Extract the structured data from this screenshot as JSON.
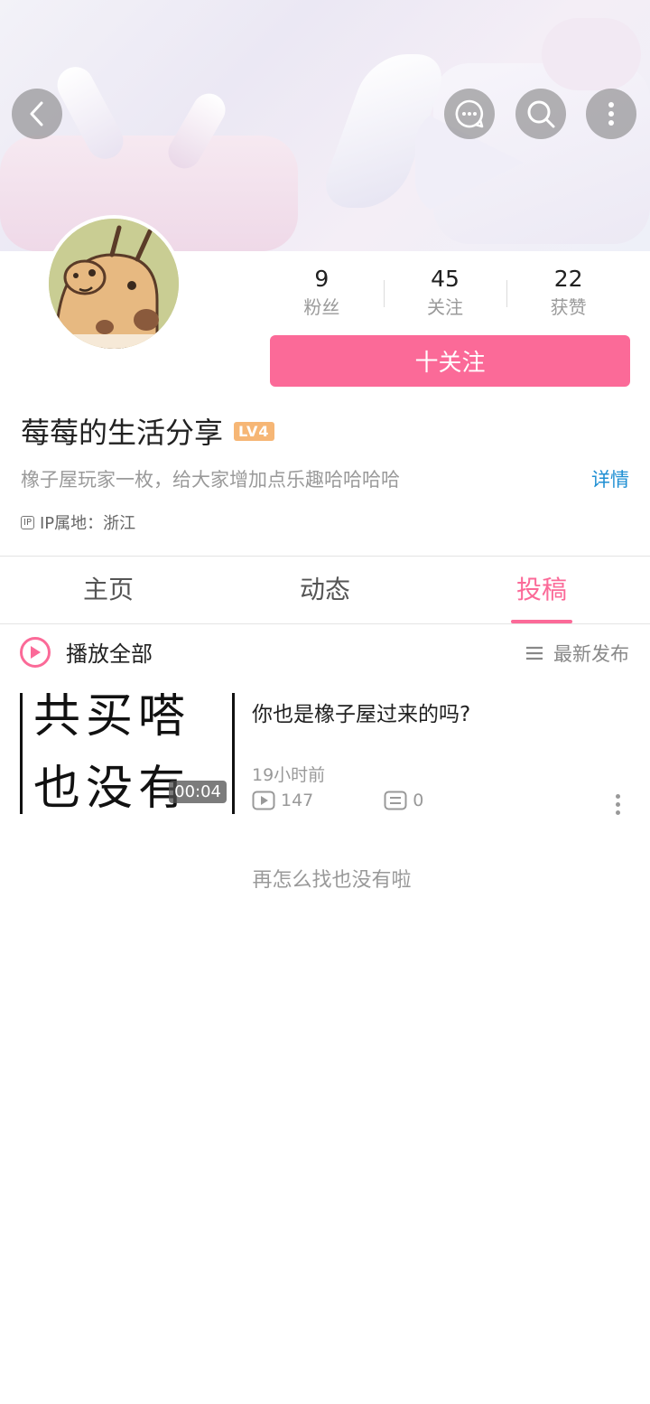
{
  "header": {
    "back_icon": "chevron-left-icon",
    "message_icon": "chat-bubble-icon",
    "search_icon": "search-icon",
    "more_icon": "more-vertical-icon"
  },
  "profile": {
    "name": "莓莓的生活分享",
    "level": "LV4",
    "bio": "橡子屋玩家一枚，给大家增加点乐趣哈哈哈哈",
    "detail_label": "详情",
    "ip_tag": "IP",
    "ip_location": "IP属地：浙江",
    "follow_label": "十关注"
  },
  "stats": [
    {
      "value": "9",
      "label": "粉丝"
    },
    {
      "value": "45",
      "label": "关注"
    },
    {
      "value": "22",
      "label": "获赞"
    }
  ],
  "tabs": [
    {
      "label": "主页",
      "active": false
    },
    {
      "label": "动态",
      "active": false
    },
    {
      "label": "投稿",
      "active": true
    }
  ],
  "list_header": {
    "play_all_label": "播放全部",
    "sort_label": "最新发布"
  },
  "videos": [
    {
      "thumb_line1": "共买嗒",
      "thumb_line2": "也没有",
      "duration": "00:04",
      "title": "你也是橡子屋过来的吗?",
      "time": "19小时前",
      "plays": "147",
      "comments": "0"
    }
  ],
  "end_text": "再怎么找也没有啦",
  "colors": {
    "accent": "#fb6a98",
    "link": "#1f8fd3",
    "level_badge": "#f6b675"
  }
}
